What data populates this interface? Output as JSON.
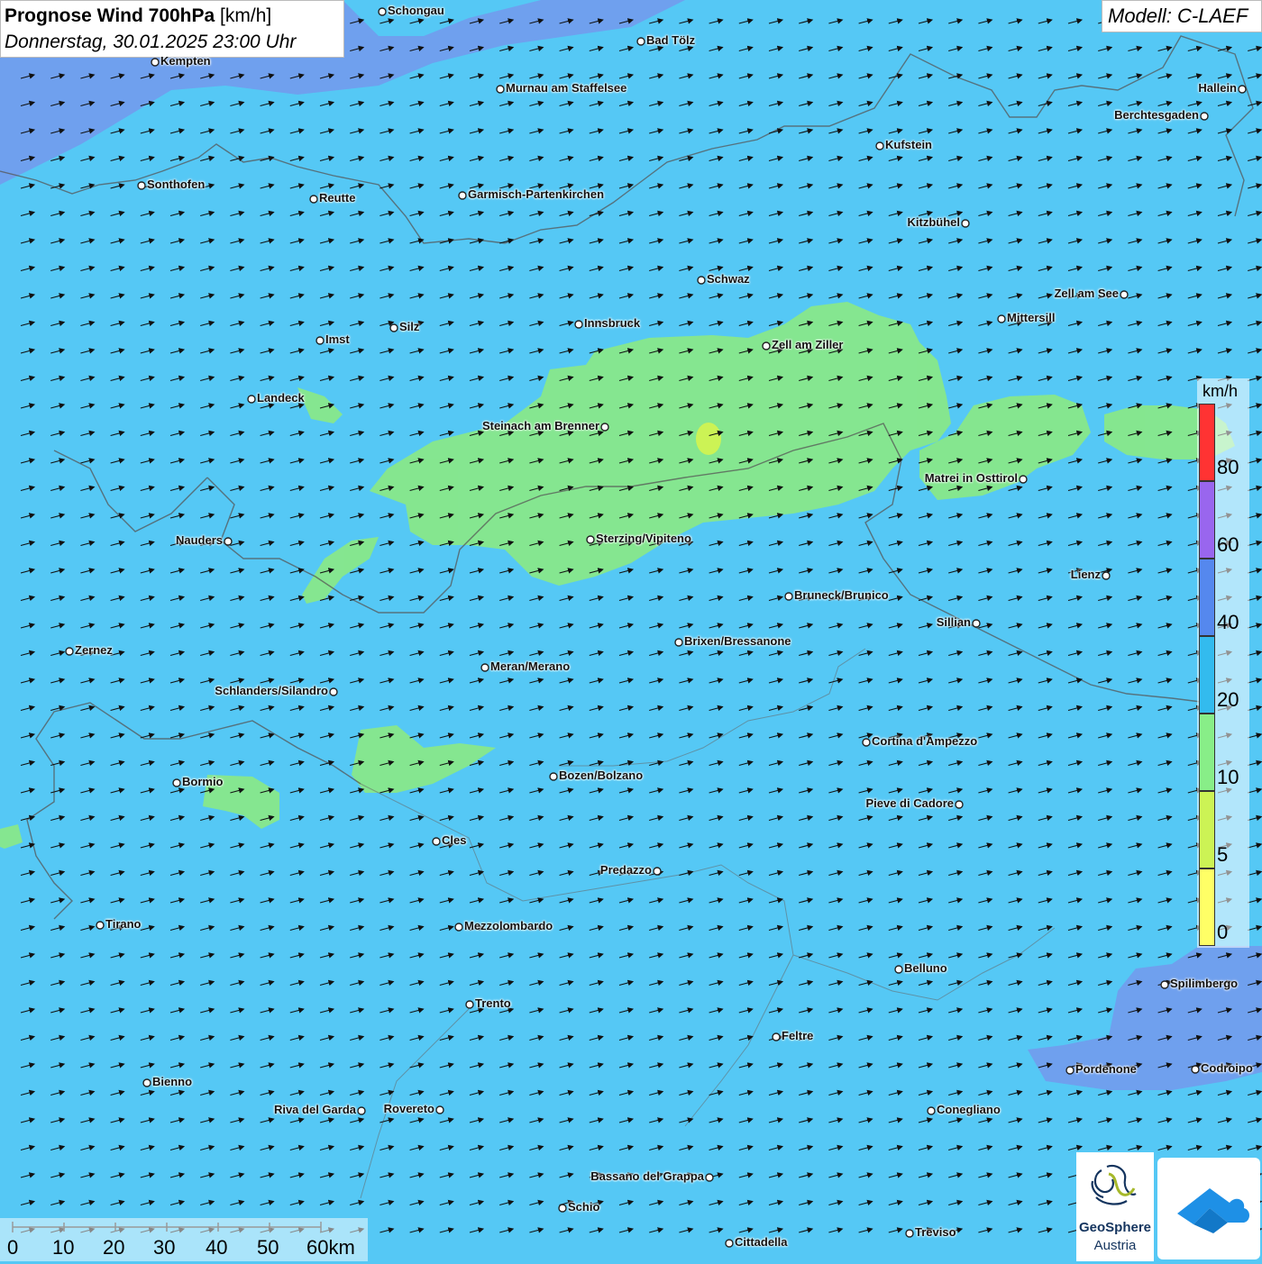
{
  "header": {
    "title_bold": "Prognose Wind 700hPa",
    "title_unit": " [km/h]",
    "subtitle": "Donnerstag, 30.01.2025 23:00 Uhr",
    "model": "Modell: C-LAEF"
  },
  "legend": {
    "unit": "km/h",
    "bins": [
      {
        "label": "80",
        "color": "#ff3333"
      },
      {
        "label": "60",
        "color": "#9966ee"
      },
      {
        "label": "40",
        "color": "#5588ee"
      },
      {
        "label": "20",
        "color": "#33bbee"
      },
      {
        "label": "10",
        "color": "#88ee88"
      },
      {
        "label": "5",
        "color": "#ccf355"
      },
      {
        "label": "0",
        "color": "#ffff66"
      }
    ]
  },
  "scale_bar": {
    "labels": [
      "0",
      "10",
      "20",
      "30",
      "40",
      "50",
      "60km"
    ]
  },
  "logos": {
    "geosphere_name": "GeoSphere",
    "geosphere_sub": "Austria"
  },
  "cities": [
    {
      "name": "Schongau",
      "label": "right"
    },
    {
      "name": "Bad Tölz",
      "label": "right"
    },
    {
      "name": "Kempten",
      "label": "right"
    },
    {
      "name": "Murnau am Staffelsee",
      "label": "right"
    },
    {
      "name": "Hallein",
      "label": "left"
    },
    {
      "name": "Berchtesgaden",
      "label": "left"
    },
    {
      "name": "Kufstein",
      "label": "right"
    },
    {
      "name": "Sonthofen",
      "label": "right"
    },
    {
      "name": "Reutte",
      "label": "right"
    },
    {
      "name": "Garmisch-Partenkirchen",
      "label": "right"
    },
    {
      "name": "Kitzbühel",
      "label": "left"
    },
    {
      "name": "Schwaz",
      "label": "right"
    },
    {
      "name": "Zell am See",
      "label": "left"
    },
    {
      "name": "Innsbruck",
      "label": "right"
    },
    {
      "name": "Mittersill",
      "label": "right"
    },
    {
      "name": "Silz",
      "label": "right"
    },
    {
      "name": "Imst",
      "label": "right"
    },
    {
      "name": "Zell am Ziller",
      "label": "right"
    },
    {
      "name": "Landeck",
      "label": "right"
    },
    {
      "name": "Steinach am Brenner",
      "label": "left"
    },
    {
      "name": "Matrei in Osttirol",
      "label": "left"
    },
    {
      "name": "Nauders",
      "label": "left"
    },
    {
      "name": "Sterzing/Vipiteno",
      "label": "right"
    },
    {
      "name": "Lienz",
      "label": "left"
    },
    {
      "name": "Bruneck/Brunico",
      "label": "right"
    },
    {
      "name": "Sillian",
      "label": "left"
    },
    {
      "name": "Zernez",
      "label": "right"
    },
    {
      "name": "Brixen/Bressanone",
      "label": "right"
    },
    {
      "name": "Meran/Merano",
      "label": "right"
    },
    {
      "name": "Schlanders/Silandro",
      "label": "left"
    },
    {
      "name": "Cortina d'Ampezzo",
      "label": "right"
    },
    {
      "name": "Bozen/Bolzano",
      "label": "right"
    },
    {
      "name": "Bormio",
      "label": "right"
    },
    {
      "name": "Pieve di Cadore",
      "label": "left"
    },
    {
      "name": "Cles",
      "label": "right"
    },
    {
      "name": "Predazzo",
      "label": "left"
    },
    {
      "name": "Tirano",
      "label": "right"
    },
    {
      "name": "Mezzolombardo",
      "label": "right"
    },
    {
      "name": "Belluno",
      "label": "right"
    },
    {
      "name": "Spilimbergo",
      "label": "right"
    },
    {
      "name": "Trento",
      "label": "right"
    },
    {
      "name": "Feltre",
      "label": "right"
    },
    {
      "name": "Pordenone",
      "label": "right"
    },
    {
      "name": "Codroipo",
      "label": "right"
    },
    {
      "name": "Bienno",
      "label": "right"
    },
    {
      "name": "Riva del Garda",
      "label": "left"
    },
    {
      "name": "Rovereto",
      "label": "left"
    },
    {
      "name": "Conegliano",
      "label": "right"
    },
    {
      "name": "Bassano del Grappa",
      "label": "left"
    },
    {
      "name": "Schio",
      "label": "right"
    },
    {
      "name": "Treviso",
      "label": "right"
    },
    {
      "name": "Cittadella",
      "label": "right"
    }
  ]
}
